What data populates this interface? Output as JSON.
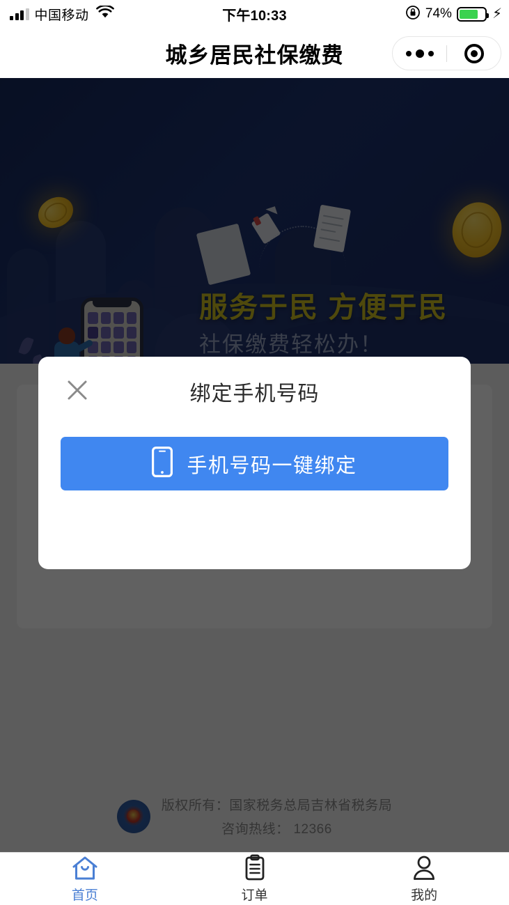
{
  "status_bar": {
    "carrier": "中国移动",
    "time": "下午10:33",
    "battery_percent": "74%",
    "battery_level": 74,
    "icons": [
      "signal-bars-icon",
      "wifi-icon",
      "rotation-lock-icon",
      "battery-icon",
      "charging-bolt-icon"
    ]
  },
  "navbar": {
    "title": "城乡居民社保缴费",
    "capsule": {
      "more_icon": "more-dots-icon",
      "target_icon": "target-circle-icon"
    }
  },
  "banner": {
    "headline": "服务于民  方便于民",
    "subhead": "社保缴费轻松办！",
    "headline_color": "#cfc021",
    "subhead_color": "#9aa6c4",
    "background_color": "#1d3370"
  },
  "modal": {
    "title": "绑定手机号码",
    "close_icon": "close-x-icon",
    "primary_button": {
      "label": "手机号码一键绑定",
      "icon": "mobile-phone-icon",
      "color": "#4087f0"
    }
  },
  "footer": {
    "emblem_icon": "tax-bureau-emblem-icon",
    "copyright": "版权所有：国家税务总局吉林省税务局",
    "hotline": "咨询热线： 12366"
  },
  "tabbar": {
    "items": [
      {
        "label": "首页",
        "icon": "home-icon",
        "active": true
      },
      {
        "label": "订单",
        "icon": "clipboard-icon",
        "active": false
      },
      {
        "label": "我的",
        "icon": "person-icon",
        "active": false
      }
    ],
    "active_color": "#4a7fd4",
    "inactive_color": "#333333"
  }
}
